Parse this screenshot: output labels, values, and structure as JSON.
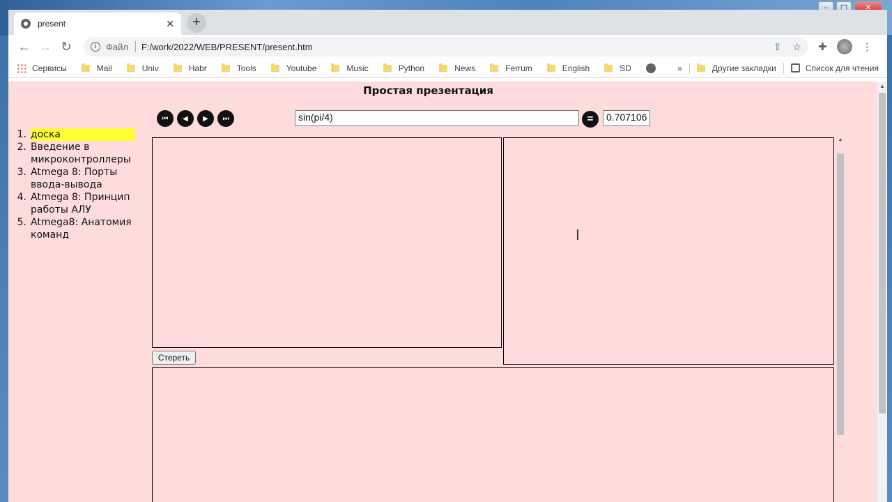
{
  "browser": {
    "tab_title": "present",
    "omnibox": {
      "scheme": "Файл",
      "url": "F:/work/2022/WEB/PRESENT/present.htm"
    },
    "bookmarks": [
      "Mail",
      "Univ",
      "Habr",
      "Tools",
      "Youtube",
      "Music",
      "Python",
      "News",
      "Ferrum",
      "English",
      "SD"
    ],
    "apps_label": "Сервисы",
    "other_bookmarks": "Другие закладки",
    "reading_list": "Список для чтения",
    "overflow": "»"
  },
  "page": {
    "title": "Простая презентация",
    "menu": [
      {
        "num": "1.",
        "label": "доска"
      },
      {
        "num": "2.",
        "label": "Введение в микроконтроллеры"
      },
      {
        "num": "3.",
        "label": "Atmega 8: Порты ввода-вывода"
      },
      {
        "num": "4.",
        "label": "Atmega 8: Принцип работы АЛУ"
      },
      {
        "num": "5.",
        "label": "Atmega8: Анатомия команд"
      }
    ],
    "expression": "sin(pi/4)",
    "equals_label": "=",
    "result": "0.707106",
    "clear_button": "Стереть"
  }
}
